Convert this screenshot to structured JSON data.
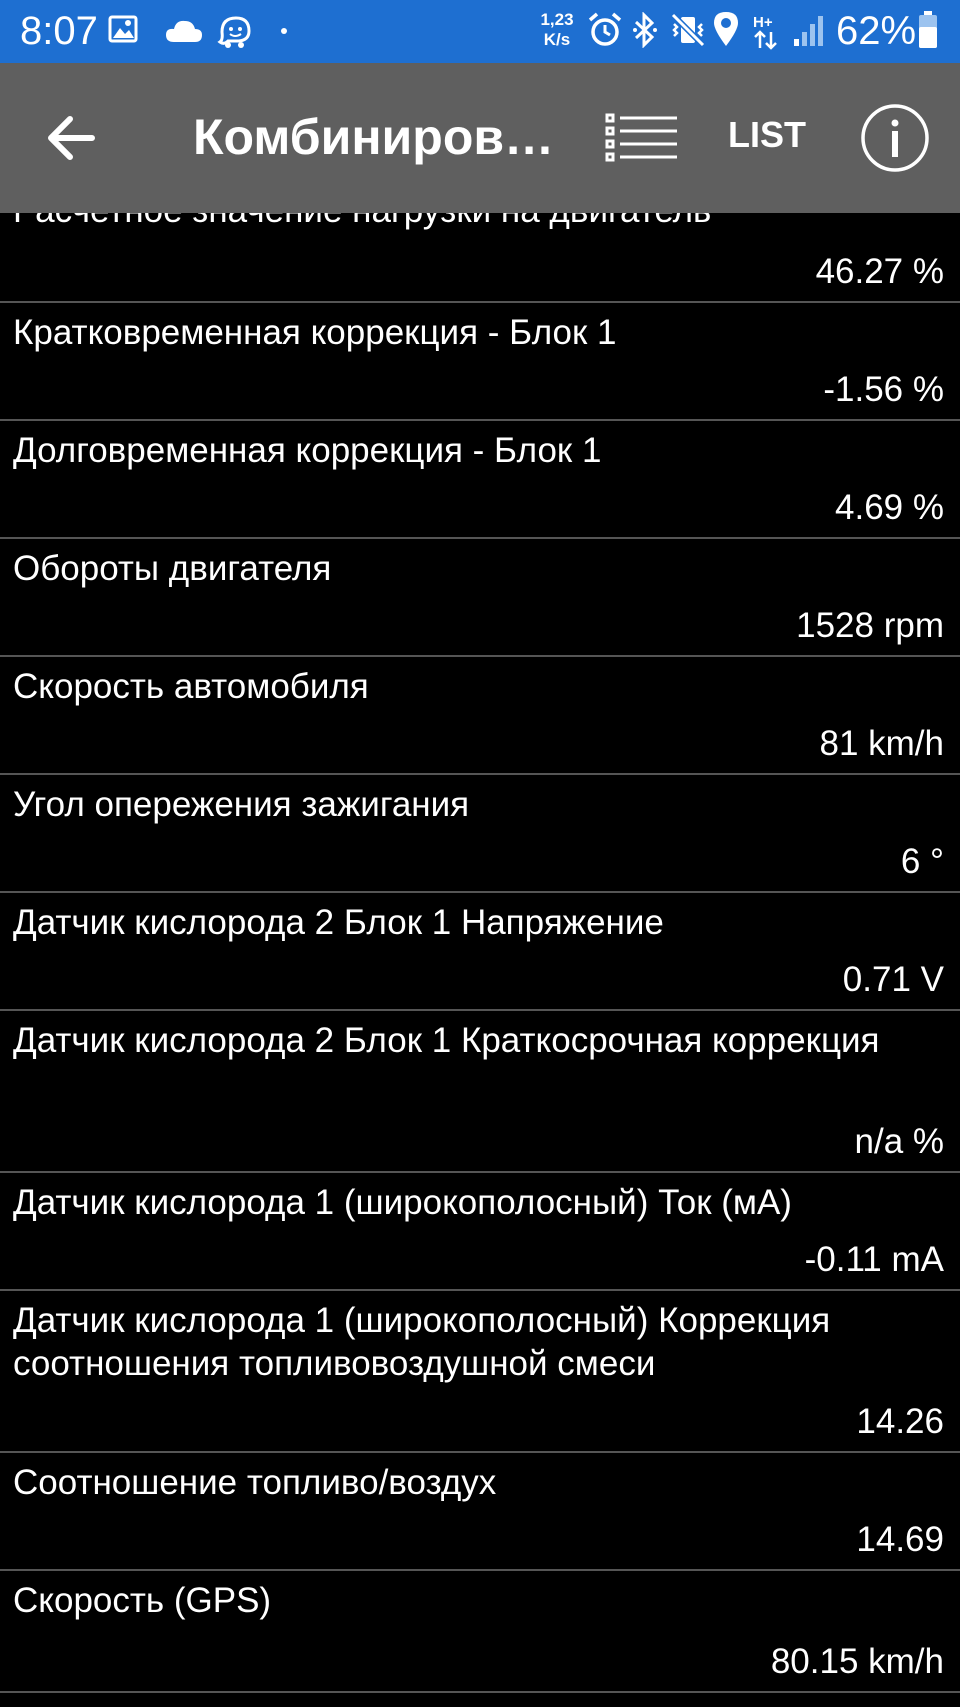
{
  "status_bar": {
    "time": "8:07",
    "net_speed_top": "1,23",
    "net_speed_bottom": "K/s",
    "battery": "62%",
    "icons": [
      "image-icon",
      "cloud-icon",
      "waze-icon",
      "dot-icon",
      "alarm-icon",
      "bluetooth-icon",
      "mute-vibrate-icon",
      "location-icon",
      "hplus-icon",
      "signal-icon",
      "battery-icon"
    ]
  },
  "app_bar": {
    "title": "Комбиниров…",
    "list_label": "LIST",
    "icons": [
      "back-arrow-icon",
      "list-view-icon",
      "info-icon"
    ]
  },
  "rows": [
    {
      "name": "Расчетное значение нагрузки на двигатель",
      "value": "46.27 %"
    },
    {
      "name": "Кратковременная коррекция - Блок 1",
      "value": "-1.56 %"
    },
    {
      "name": "Долговременная коррекция - Блок 1",
      "value": "4.69 %"
    },
    {
      "name": "Обороты двигателя",
      "value": "1528 rpm"
    },
    {
      "name": "Скорость автомобиля",
      "value": "81 km/h"
    },
    {
      "name": "Угол опережения зажигания",
      "value": "6 °"
    },
    {
      "name": "Датчик кислорода 2 Блок 1 Напряжение",
      "value": "0.71 V"
    },
    {
      "name": "Датчик кислорода 2 Блок 1 Краткосрочная коррекция",
      "value": "n/a %"
    },
    {
      "name": "Датчик кислорода 1 (широкополосный) Ток (мА)",
      "value": "-0.11 mA"
    },
    {
      "name": "Датчик кислорода 1 (широкополосный) Коррекция соотношения топливовоздушной смеси",
      "value": "14.26"
    },
    {
      "name": "Соотношение топливо/воздух",
      "value": "14.69"
    },
    {
      "name": "Скорость (GPS)",
      "value": "80.15 km/h"
    }
  ],
  "colors": {
    "status_bar": "#1e6fd1",
    "app_bar": "#5f5f5f",
    "background": "#000000",
    "text": "#ffffff",
    "divider": "#555555"
  }
}
